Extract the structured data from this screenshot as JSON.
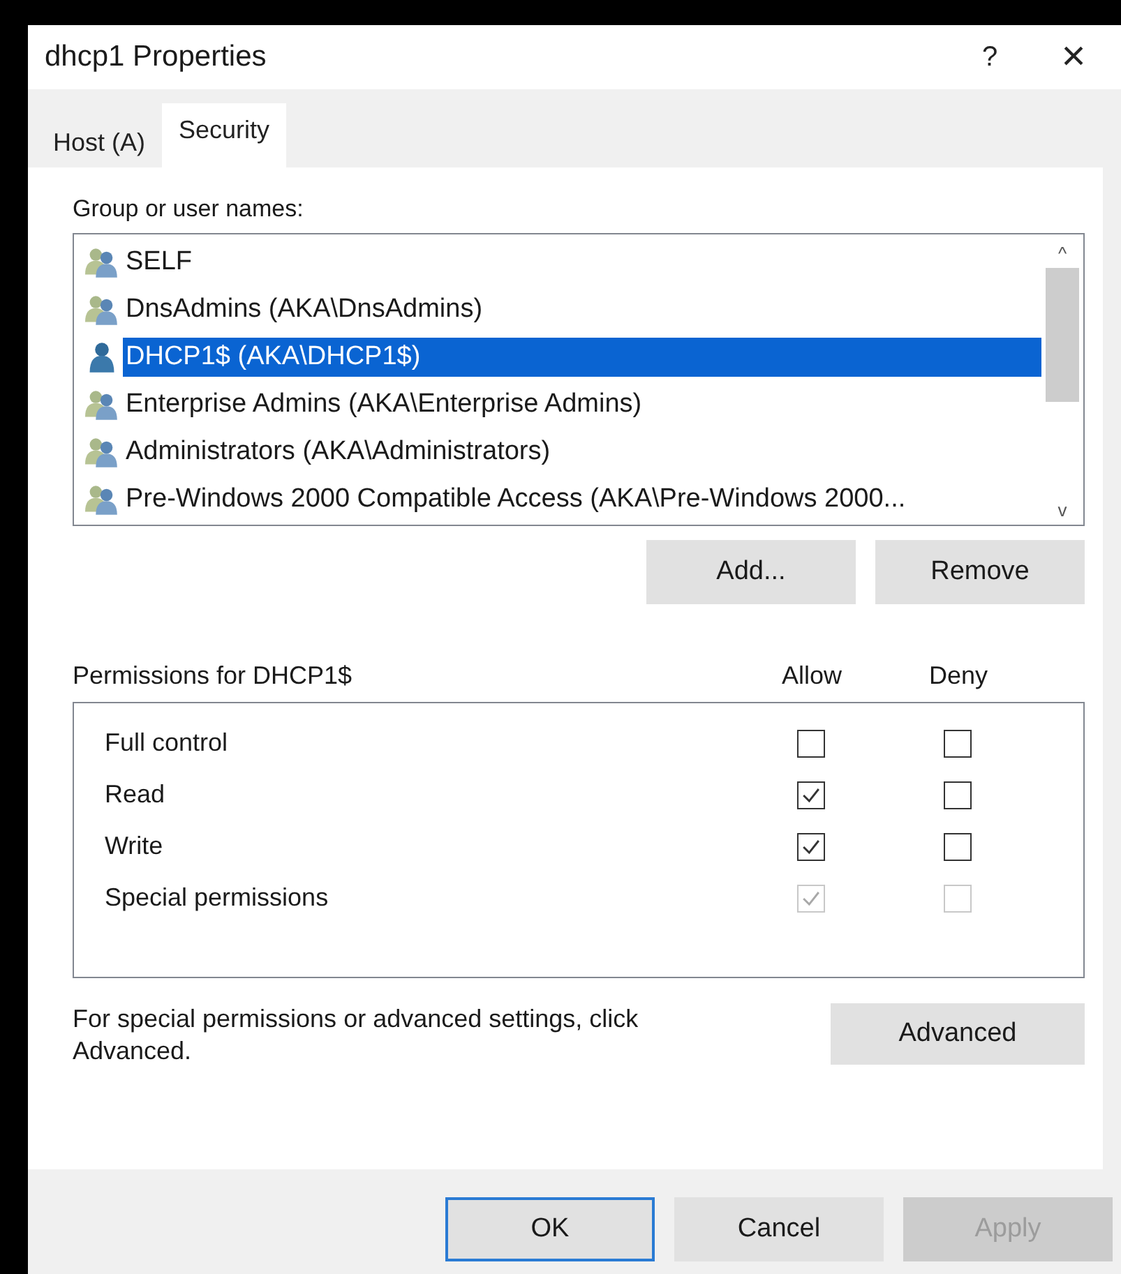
{
  "window": {
    "title": "dhcp1 Properties",
    "help": "?",
    "close": "×"
  },
  "tabs": [
    {
      "label": "Host (A)",
      "selected": false
    },
    {
      "label": "Security",
      "selected": true
    }
  ],
  "users": {
    "label": "Group or user names:",
    "items": [
      {
        "name": "SELF",
        "kind": "group",
        "selected": false
      },
      {
        "name": "DnsAdmins (AKA\\DnsAdmins)",
        "kind": "group",
        "selected": false
      },
      {
        "name": "DHCP1$ (AKA\\DHCP1$)",
        "kind": "user",
        "selected": true
      },
      {
        "name": "Enterprise Admins (AKA\\Enterprise Admins)",
        "kind": "group",
        "selected": false
      },
      {
        "name": "Administrators (AKA\\Administrators)",
        "kind": "group",
        "selected": false
      },
      {
        "name": "Pre-Windows 2000 Compatible Access (AKA\\Pre-Windows 2000...",
        "kind": "group",
        "selected": false
      }
    ],
    "scroll_up": "^",
    "scroll_down": "v"
  },
  "user_buttons": [
    {
      "label": "Add..."
    },
    {
      "label": "Remove"
    }
  ],
  "permissions": {
    "label": "Permissions for DHCP1$",
    "allow_header": "Allow",
    "deny_header": "Deny",
    "rows": [
      {
        "name": "Full control",
        "allow": false,
        "deny": false,
        "disabled": false
      },
      {
        "name": "Read",
        "allow": true,
        "deny": false,
        "disabled": false
      },
      {
        "name": "Write",
        "allow": true,
        "deny": false,
        "disabled": false
      },
      {
        "name": "Special permissions",
        "allow": true,
        "deny": false,
        "disabled": true
      }
    ]
  },
  "advanced": {
    "text": "For special permissions or advanced settings, click Advanced.",
    "button": "Advanced"
  },
  "buttons": [
    {
      "label": "OK",
      "default": true,
      "disabled": false
    },
    {
      "label": "Cancel",
      "default": false,
      "disabled": false
    },
    {
      "label": "Apply",
      "default": false,
      "disabled": true
    }
  ]
}
